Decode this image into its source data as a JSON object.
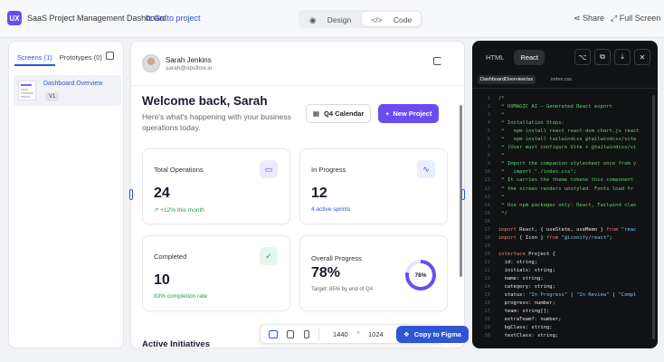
{
  "header": {
    "logo_text": "UX",
    "app_title": "SaaS Project Management Dashboard",
    "go_to_project": "Go to project",
    "view_toggle": {
      "design": "Design",
      "code": "Code",
      "active": "code"
    },
    "share": "Share",
    "full_screen": "Full Screen"
  },
  "left_panel": {
    "tabs": [
      {
        "label": "Screens (1)",
        "active": true
      },
      {
        "label": "Prototypes (0)",
        "active": false
      }
    ],
    "screens": [
      {
        "label": "Dashboard Overview",
        "version": "V1"
      }
    ]
  },
  "dashboard": {
    "user": {
      "name": "Sarah Jenkins",
      "email": "sarah@opsflow.io"
    },
    "welcome_title": "Welcome back, Sarah",
    "welcome_sub": "Here's what's happening with your business operations today.",
    "calendar_button": "Q4 Calendar",
    "new_project_button": "New Project",
    "cards": {
      "total_operations": {
        "title": "Total Operations",
        "value": "24",
        "note": "+12% this month"
      },
      "in_progress": {
        "title": "In Progress",
        "value": "12",
        "note": "4 active sprints"
      },
      "completed": {
        "title": "Completed",
        "value": "10",
        "note": "83% completion rate"
      },
      "overall_progress": {
        "title": "Overall Progress",
        "value": "78%",
        "note": "Target: 85% by end of Q4",
        "ring_label": "78%",
        "ring_fraction": 0.78
      }
    },
    "section_title": "Active Initiatives"
  },
  "toolbar": {
    "width": "1440",
    "times": "×",
    "height": "1024",
    "copy_to_figma": "Copy to Figma"
  },
  "code_panel": {
    "tabs": [
      {
        "label": "HTML",
        "active": false
      },
      {
        "label": "React",
        "active": true
      }
    ],
    "files": [
      {
        "label": "DashboardOverview.tsx",
        "active": true
      },
      {
        "label": "index.css",
        "active": false
      }
    ],
    "lines": [
      [
        {
          "c": "cmt",
          "t": "/*"
        }
      ],
      [
        {
          "c": "cmt",
          "t": " * UXMAGIC AI — Generated React export"
        }
      ],
      [
        {
          "c": "cmt",
          "t": " *"
        }
      ],
      [
        {
          "c": "cmt",
          "t": " * Installation Steps:"
        }
      ],
      [
        {
          "c": "cmt",
          "t": " *   npm install react react-dom chart.js react"
        }
      ],
      [
        {
          "c": "cmt",
          "t": " *   npm install tailwindcss @tailwindcss/vite"
        }
      ],
      [
        {
          "c": "cmt",
          "t": " * (User must configure Vite + @tailwindcss/vi"
        }
      ],
      [
        {
          "c": "cmt",
          "t": " *"
        }
      ],
      [
        {
          "c": "cmt",
          "t": " * Import the companion stylesheet once from y"
        }
      ],
      [
        {
          "c": "cmt",
          "t": " *   import \"./index.css\";"
        }
      ],
      [
        {
          "c": "cmt",
          "t": " * It carries the theme tokens this component"
        }
      ],
      [
        {
          "c": "cmt",
          "t": " * the screen renders unstyled. Fonts load fr"
        }
      ],
      [
        {
          "c": "cmt",
          "t": " *"
        }
      ],
      [
        {
          "c": "cmt",
          "t": " * Use npm packages only: React, Tailwind clas"
        }
      ],
      [
        {
          "c": "cmt",
          "t": " */"
        }
      ],
      [],
      [
        {
          "c": "kw",
          "t": "import"
        },
        {
          "c": "tx",
          "t": " React, { useState, useMemo } "
        },
        {
          "c": "kw",
          "t": "from"
        },
        {
          "c": "str",
          "t": " \"reac"
        }
      ],
      [
        {
          "c": "kw",
          "t": "import"
        },
        {
          "c": "tx",
          "t": " { Icon } "
        },
        {
          "c": "kw",
          "t": "from"
        },
        {
          "c": "str",
          "t": " \"@iconify/react\""
        },
        {
          "c": "tx",
          "t": ";"
        }
      ],
      [],
      [
        {
          "c": "kw",
          "t": "interface"
        },
        {
          "c": "tx",
          "t": " Project {"
        }
      ],
      [
        {
          "c": "tx",
          "t": "  id: string;"
        }
      ],
      [
        {
          "c": "tx",
          "t": "  initials: string;"
        }
      ],
      [
        {
          "c": "tx",
          "t": "  name: string;"
        }
      ],
      [
        {
          "c": "tx",
          "t": "  category: string;"
        }
      ],
      [
        {
          "c": "tx",
          "t": "  status: "
        },
        {
          "c": "str",
          "t": "\"In Progress\""
        },
        {
          "c": "tx",
          "t": " | "
        },
        {
          "c": "str",
          "t": "\"In Review\""
        },
        {
          "c": "tx",
          "t": " | "
        },
        {
          "c": "str",
          "t": "\"Compl"
        }
      ],
      [
        {
          "c": "tx",
          "t": "  progress: number;"
        }
      ],
      [
        {
          "c": "tx",
          "t": "  team: string[];"
        }
      ],
      [
        {
          "c": "tx",
          "t": "  extraTeam?: number;"
        }
      ],
      [
        {
          "c": "tx",
          "t": "  bgClass: string;"
        }
      ],
      [
        {
          "c": "tx",
          "t": "  textClass: string;"
        }
      ]
    ]
  },
  "colors": {
    "accent": "#6c4cf1",
    "link": "#2f55d4",
    "success": "#1f9d55",
    "code_bg": "#111214",
    "ring_track": "#e7e1fd"
  }
}
